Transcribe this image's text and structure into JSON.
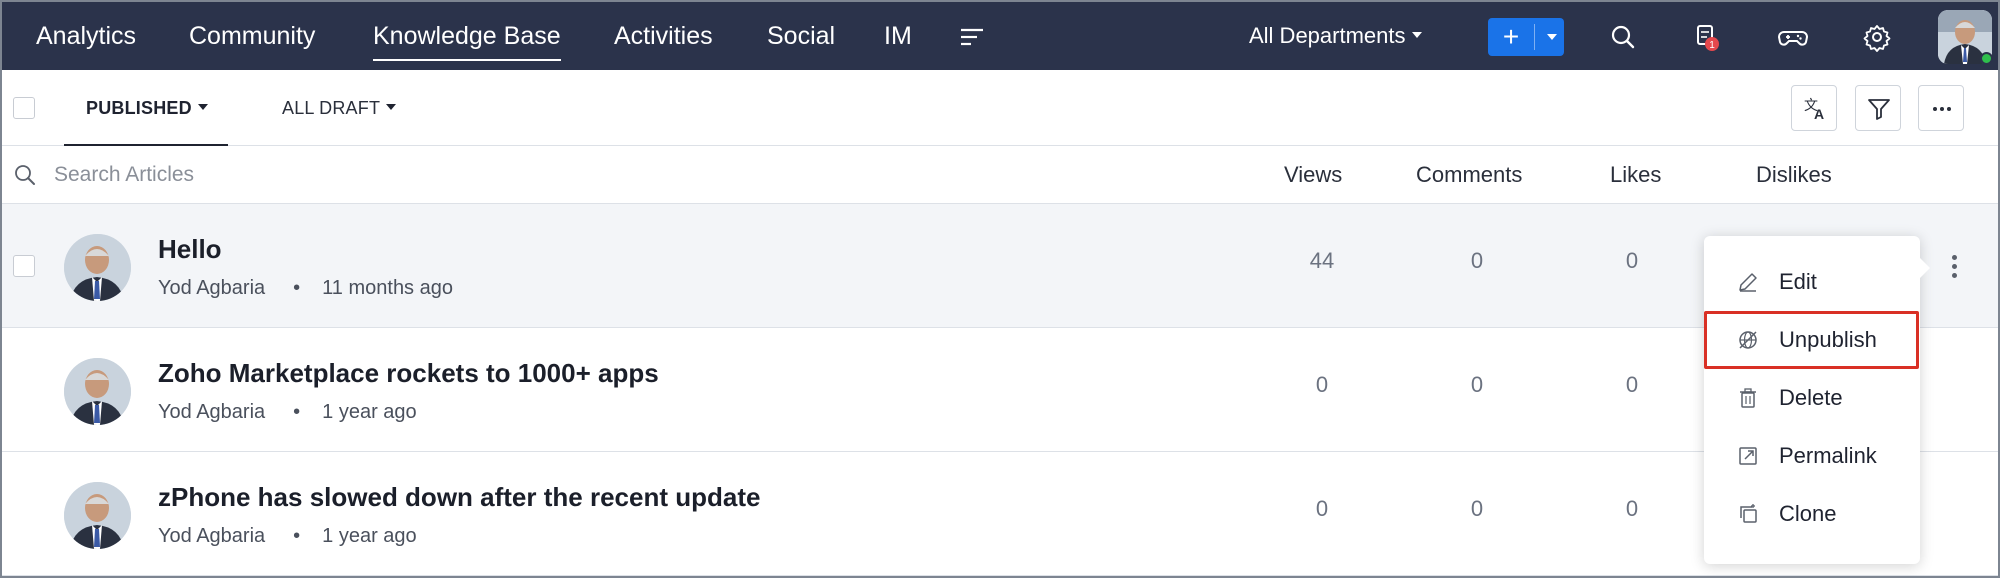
{
  "topnav": {
    "links": [
      "Analytics",
      "Community",
      "Knowledge Base",
      "Activities",
      "Social",
      "IM"
    ],
    "active_link": "Knowledge Base",
    "department": "All Departments",
    "add_label": "+",
    "notification_count": "1",
    "icons": [
      "menu-icon",
      "search-icon",
      "notification-icon",
      "gamepad-icon",
      "gear-icon"
    ]
  },
  "toolbar": {
    "tabs": [
      "PUBLISHED",
      "ALL DRAFT"
    ],
    "active_tab": "PUBLISHED",
    "buttons": [
      "translate-icon",
      "filter-icon",
      "more-icon"
    ]
  },
  "table": {
    "search_placeholder": "Search Articles",
    "columns": [
      "Views",
      "Comments",
      "Likes",
      "Dislikes"
    ],
    "rows": [
      {
        "title": "Hello",
        "author": "Yod Agbaria",
        "time": "11 months ago",
        "views": "44",
        "comments": "0",
        "likes": "0"
      },
      {
        "title": "Zoho Marketplace rockets to 1000+ apps",
        "author": "Yod Agbaria",
        "time": "1 year ago",
        "views": "0",
        "comments": "0",
        "likes": "0"
      },
      {
        "title": "zPhone has slowed down after the recent update",
        "author": "Yod Agbaria",
        "time": "1 year ago",
        "views": "0",
        "comments": "0",
        "likes": "0"
      }
    ],
    "meta_separator": "•"
  },
  "context_menu": {
    "items": [
      {
        "label": "Edit",
        "icon": "edit-icon"
      },
      {
        "label": "Unpublish",
        "icon": "unpublish-icon"
      },
      {
        "label": "Delete",
        "icon": "trash-icon"
      },
      {
        "label": "Permalink",
        "icon": "external-link-icon"
      },
      {
        "label": "Clone",
        "icon": "clone-icon"
      }
    ],
    "highlighted_item": "Unpublish",
    "highlight_color": "#d93025"
  },
  "colors": {
    "nav_bg": "#2b334b",
    "accent": "#1a73e8",
    "badge": "#e5484d",
    "online": "#2fbf4d"
  }
}
